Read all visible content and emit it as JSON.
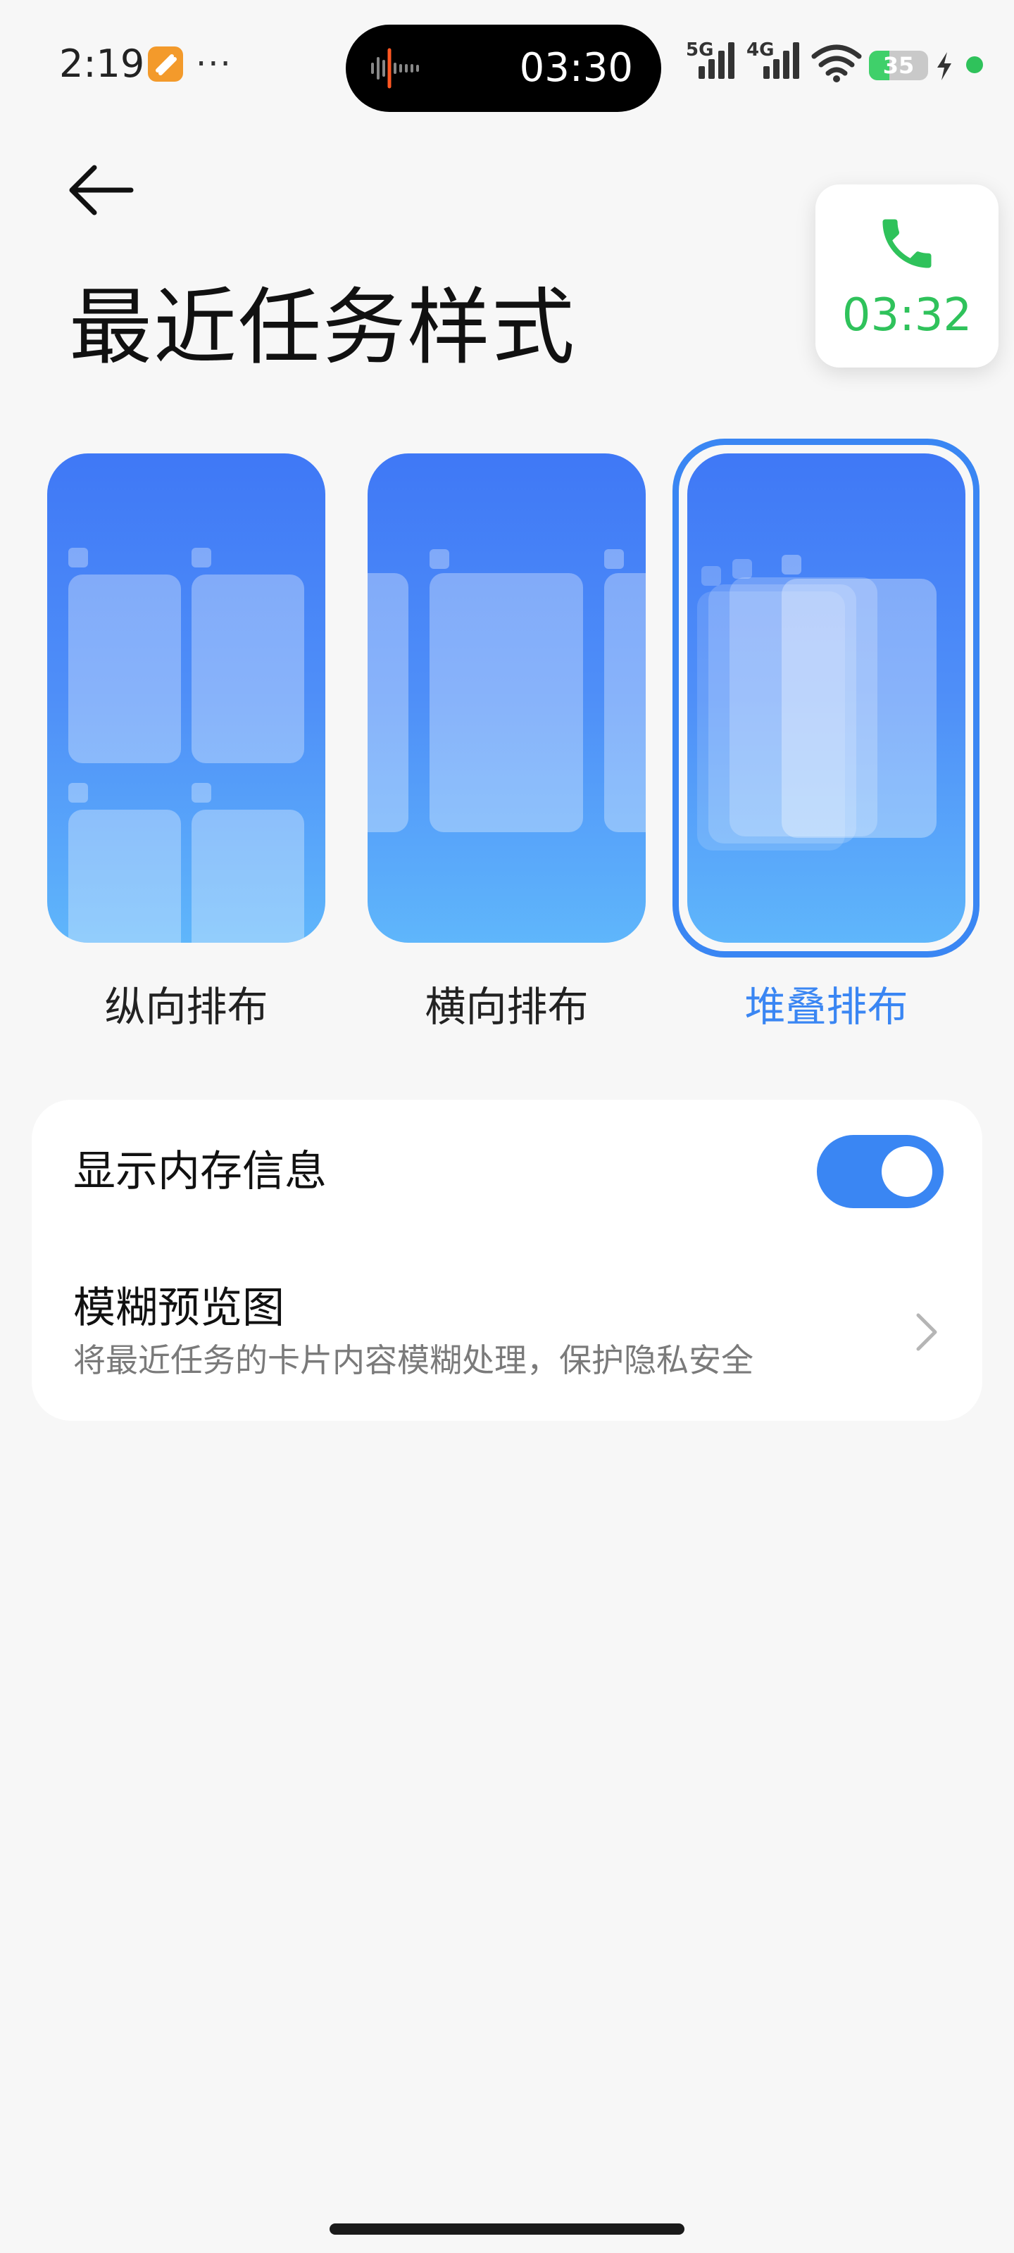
{
  "status_bar": {
    "time": "2:19",
    "more": "···",
    "island_time": "03:30",
    "net_5g": "5G",
    "net_4g": "4G",
    "battery_level": "35",
    "battery_fraction": 0.35
  },
  "floating_call": {
    "timer": "03:32"
  },
  "page": {
    "title": "最近任务样式"
  },
  "layout_options": [
    {
      "label": "纵向排布",
      "selected": false
    },
    {
      "label": "横向排布",
      "selected": false
    },
    {
      "label": "堆叠排布",
      "selected": true
    }
  ],
  "settings": {
    "show_memory": {
      "label": "显示内存信息",
      "enabled": true
    },
    "blur_preview": {
      "label": "模糊预览图",
      "description": "将最近任务的卡片内容模糊处理，保护隐私安全"
    }
  },
  "colors": {
    "accent": "#3a86f3",
    "call_green": "#2fc25b",
    "app_badge": "#f39a2b"
  }
}
